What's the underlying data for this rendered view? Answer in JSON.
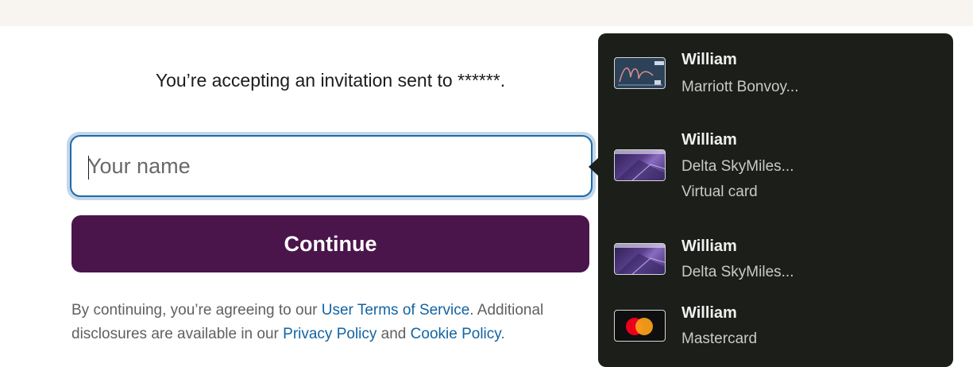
{
  "invite": {
    "text": "You’re accepting an invitation sent to ******."
  },
  "form": {
    "name_placeholder": "Your name",
    "name_value": "",
    "continue_label": "Continue"
  },
  "legal": {
    "prefix": "By continuing, you’re agreeing to our ",
    "terms_link": "User Terms of Service",
    "middle": ". Additional disclosures are available in our ",
    "privacy_link": "Privacy Policy",
    "and": " and ",
    "cookie_link": "Cookie Policy",
    "suffix": "."
  },
  "autofill": {
    "items": [
      {
        "name": "William",
        "line1": "Marriott Bonvoy...",
        "line2": "",
        "icon": "marriott-card-icon"
      },
      {
        "name": "William",
        "line1": "Delta SkyMiles...",
        "line2": "Virtual card",
        "icon": "delta-card-icon"
      },
      {
        "name": "William",
        "line1": "Delta SkyMiles...",
        "line2": "",
        "icon": "delta-card-icon"
      },
      {
        "name": "William",
        "line1": "Mastercard",
        "line2": "",
        "icon": "mastercard-icon"
      }
    ]
  },
  "colors": {
    "brand": "#4a154b",
    "link": "#1264a3",
    "dropdown_bg": "#1b1e19",
    "input_border": "#1d6aa8"
  }
}
